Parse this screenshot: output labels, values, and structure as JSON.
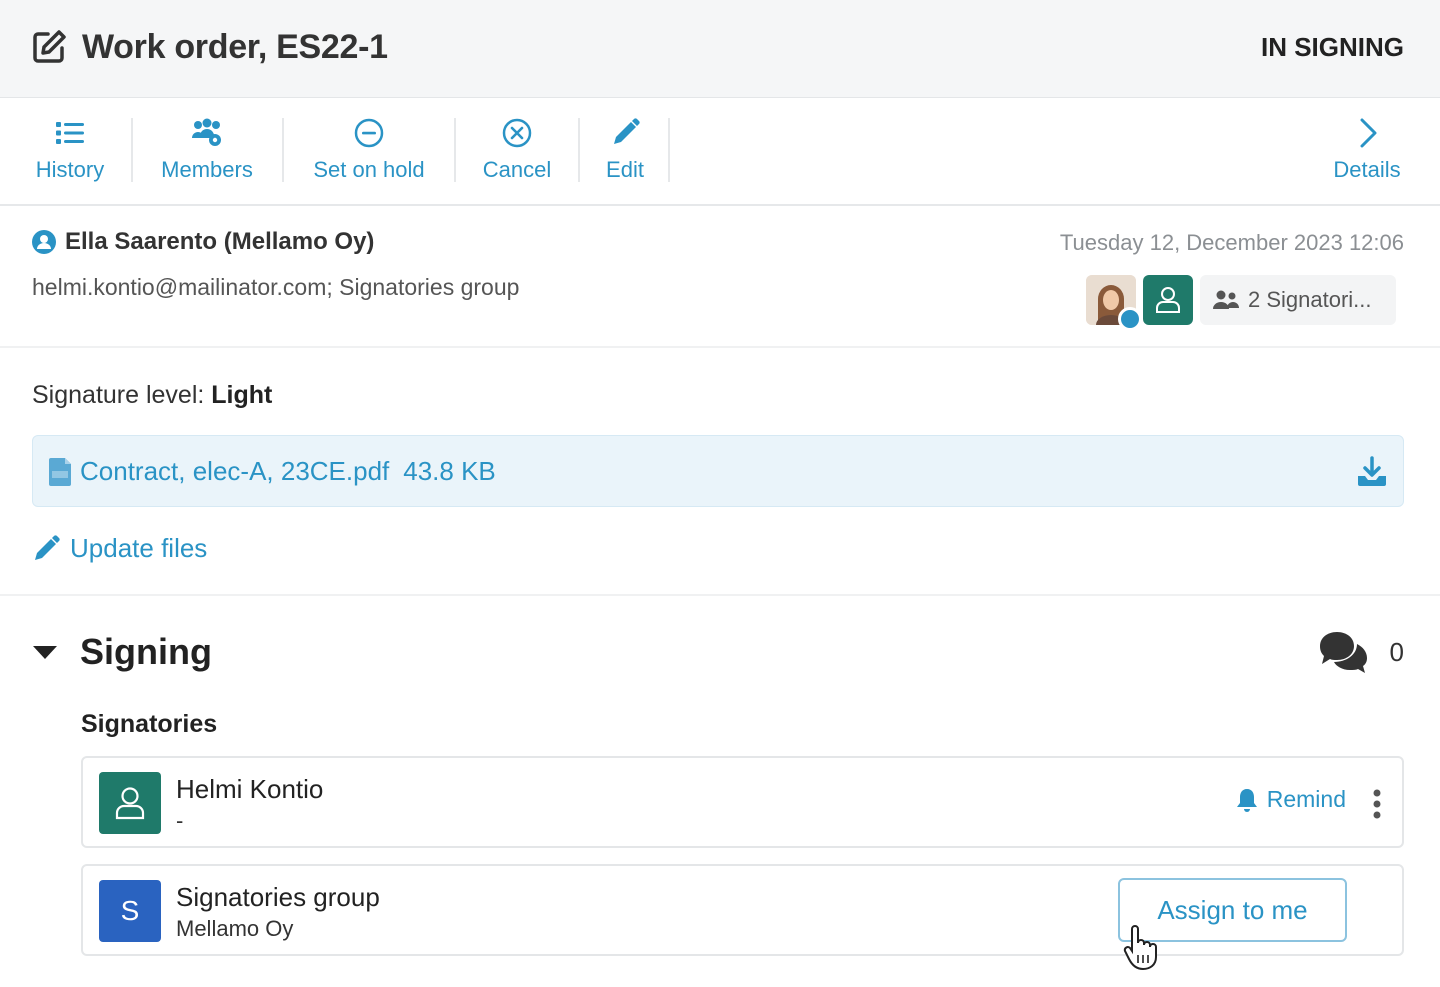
{
  "header": {
    "title": "Work order, ES22-1",
    "status": "IN SIGNING"
  },
  "toolbar": {
    "history": "History",
    "members": "Members",
    "set_on_hold": "Set on hold",
    "cancel": "Cancel",
    "edit": "Edit",
    "details": "Details"
  },
  "sender": {
    "name": "Ella Saarento (Mellamo Oy)",
    "date": "Tuesday 12, December 2023 12:06",
    "recipients": "helmi.kontio@mailinator.com;  Signatories group",
    "signatories_chip": "2 Signatori..."
  },
  "signature": {
    "label": "Signature level: ",
    "value": "Light"
  },
  "file": {
    "name": "Contract, elec-A, 23CE.pdf",
    "size": "43.8 KB"
  },
  "update_files": "Update files",
  "signing": {
    "title": "Signing",
    "comment_count": "0",
    "signatories_label": "Signatories",
    "signatories": [
      {
        "name": "Helmi Kontio",
        "sub": "-",
        "action": "Remind"
      },
      {
        "name": "Signatories group",
        "sub": "Mellamo Oy",
        "initial": "S",
        "action": "Assign to me"
      }
    ]
  },
  "colors": {
    "accent": "#2a93c5",
    "green_avatar": "#1f7a6a",
    "blue_avatar": "#2a63c0"
  }
}
